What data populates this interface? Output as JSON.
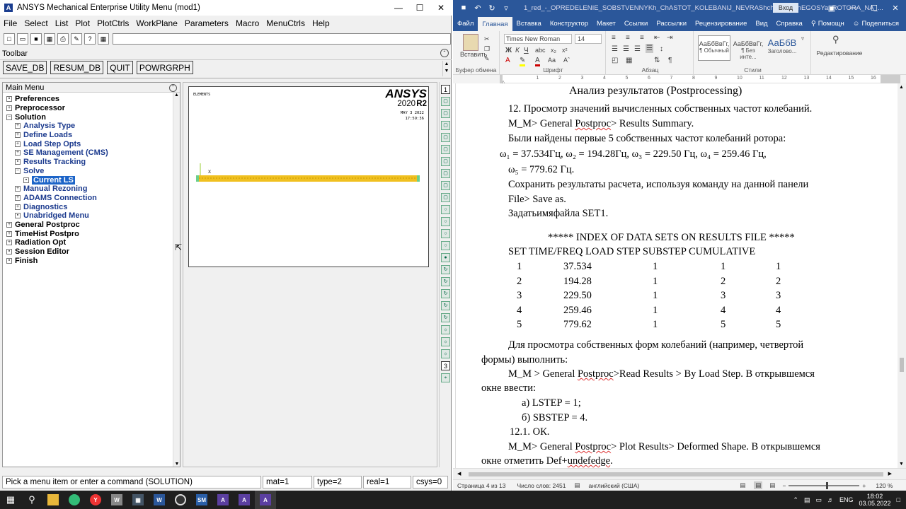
{
  "ansys": {
    "title": "ANSYS Mechanical Enterprise Utility Menu (mod1)",
    "menu": [
      "File",
      "Select",
      "List",
      "Plot",
      "PlotCtrls",
      "WorkPlane",
      "Parameters",
      "Macro",
      "MenuCtrls",
      "Help"
    ],
    "toolbar_label": "Toolbar",
    "toolbar_buttons": [
      "SAVE_DB",
      "RESUM_DB",
      "QUIT",
      "POWRGRPH"
    ],
    "main_menu_label": "Main Menu",
    "main_menu": [
      {
        "label": "Preferences",
        "level": 0,
        "box": "check"
      },
      {
        "label": "Preprocessor",
        "level": 0,
        "box": "plus"
      },
      {
        "label": "Solution",
        "level": 0,
        "box": "minus"
      },
      {
        "label": "Analysis Type",
        "level": 1,
        "box": "plus"
      },
      {
        "label": "Define Loads",
        "level": 1,
        "box": "plus"
      },
      {
        "label": "Load Step Opts",
        "level": 1,
        "box": "plus"
      },
      {
        "label": "SE Management (CMS)",
        "level": 1,
        "box": "plus"
      },
      {
        "label": "Results Tracking",
        "level": 1,
        "box": "check"
      },
      {
        "label": "Solve",
        "level": 1,
        "box": "minus"
      },
      {
        "label": "Current LS",
        "level": 2,
        "box": "check",
        "selected": true
      },
      {
        "label": "Manual Rezoning",
        "level": 1,
        "box": "plus"
      },
      {
        "label": "ADAMS Connection",
        "level": 1,
        "box": "plus"
      },
      {
        "label": "Diagnostics",
        "level": 1,
        "box": "plus"
      },
      {
        "label": "Unabridged Menu",
        "level": 1,
        "box": "check"
      },
      {
        "label": "General Postproc",
        "level": 0,
        "box": "plus"
      },
      {
        "label": "TimeHist Postpro",
        "level": 0,
        "box": "plus"
      },
      {
        "label": "Radiation Opt",
        "level": 0,
        "box": "plus"
      },
      {
        "label": "Session Editor",
        "level": 0,
        "box": "check"
      },
      {
        "label": "Finish",
        "level": 0,
        "box": "check"
      }
    ],
    "graphics": {
      "elements_label": "ELEMENTS",
      "logo": "ANSYS",
      "version": "2020",
      "release": "R2",
      "date": "MAY  3 2022",
      "time": "17:59:36",
      "axis_label": "X"
    },
    "status": {
      "prompt": "Pick a menu item or enter a command (SOLUTION)",
      "mat": "mat=1",
      "type": "type=2",
      "real": "real=1",
      "csys": "csys=0"
    },
    "side_tools_top": "1",
    "side_tools_mid": "3"
  },
  "word": {
    "doc_title": "1_red_-_OPREDELENIE_SOBSTVENNYKh_ChASTOT_KOLEBANIJ_NEVRAShchAYuShchEGOSYa_ROTORA_NA_...",
    "login": "Вход",
    "tabs": [
      "Файл",
      "Главная",
      "Вставка",
      "Конструктор",
      "Макет",
      "Ссылки",
      "Рассылки",
      "Рецензирование",
      "Вид",
      "Справка",
      "Помощн",
      "Поделиться"
    ],
    "ribbon": {
      "paste": "Вставить",
      "clipboard": "Буфер обмена",
      "font_name": "Times New Roman",
      "font_size": "14",
      "font_group": "Шрифт",
      "paragraph_group": "Абзац",
      "styles_group": "Стили",
      "editing": "Редактирование",
      "styles": [
        {
          "sample": "АаБбВвГг,",
          "name": "¶ Обычный"
        },
        {
          "sample": "АаБбВвГг,",
          "name": "¶ Без инте..."
        },
        {
          "sample": "АаБбВ",
          "name": "Заголово..."
        }
      ]
    },
    "doc": {
      "heading": "Анализ результатов (Postprocessing)",
      "p12": "12.  Просмотр  значений  вычисленных  собственных  частот  колебаний.",
      "p12b_pre": "M_M> General ",
      "p12b_u": "Postproc",
      "p12b_post": "> Results Summary.",
      "found": "Были найдены первые 5 собственных частот колебаний ротора:",
      "w_line1": "ω₁ = 37.534Гц,   ω₂ = 194.28Гц,       ω₃ = 229.50 Гц,       ω₄ = 259.46 Гц,",
      "w_line2": "ω₅ = 779.62 Гц.",
      "save1": "Сохранить результаты расчета, используя команду на данной панели",
      "save2": "File> Save as.",
      "setname": "Задатьимяфайла SET1.",
      "index_title": "***** INDEX OF DATA SETS ON RESULTS FILE *****",
      "table_header": "SET TIME/FREQ   LOAD STEP SUBSTEP CUMULATIVE",
      "table_rows": [
        [
          "1",
          "37.534",
          "1",
          "1",
          "1"
        ],
        [
          "2",
          "194.28",
          "1",
          "2",
          "2"
        ],
        [
          "3",
          "229.50",
          "1",
          "3",
          "3"
        ],
        [
          "4",
          "259.46",
          "1",
          "4",
          "4"
        ],
        [
          "5",
          "779.62",
          "1",
          "5",
          "5"
        ]
      ],
      "view1": "Для просмотра собственных форм колебаний (например, четвертой",
      "view2": "формы) выполнить:",
      "rr_pre": "M_M > General ",
      "rr_u": "Postproc",
      "rr_post": ">Read Results > By Load Step. В открывшемся",
      "rr2": "окне ввести:",
      "a": "а) LSTEP = 1;",
      "b": "б) SBSTEP = 4.",
      "ok": "12.1. ОК.",
      "ds_pre": "M_M>  General  ",
      "ds_u": "Postproc",
      "ds_post": ">  Plot  Results>  Deformed  Shape.  В  открывшемся",
      "ds2_pre": "окне отметить Def+",
      "ds2_u": "undefedge",
      "ds2_post": "."
    },
    "status": {
      "page": "Страница 4 из 13",
      "words": "Число слов: 2451",
      "lang": "английский (США)",
      "zoom": "120 %"
    }
  },
  "taskbar": {
    "lang": "ENG",
    "time": "18:02",
    "date": "03.05.2022"
  }
}
